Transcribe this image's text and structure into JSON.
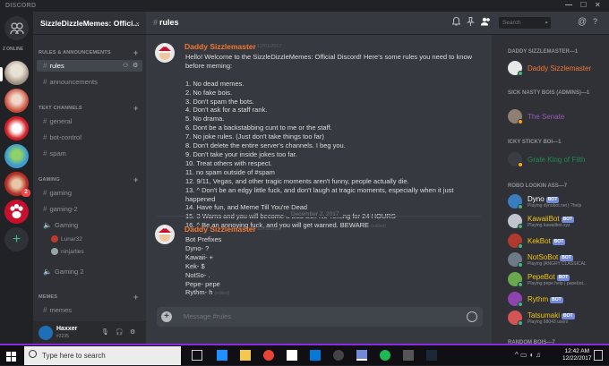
{
  "window": {
    "app_name": "DISCORD",
    "controls": [
      "—",
      "☐",
      "✕"
    ]
  },
  "rail": {
    "online_label": "2 ONLINE",
    "badge_count": "2"
  },
  "server": {
    "name": "SizzleDizzleMemes: Offici...",
    "chevron": "⌄"
  },
  "categories": {
    "rules": "RULES & ANNOUNCEMENTS",
    "text": "TEXT CHANNELS",
    "gaming": "GAMING",
    "memes": "MEMES"
  },
  "channels": {
    "rules": "rules",
    "announcements": "announcements",
    "general": "general",
    "bot_control": "bot-control",
    "spam": "spam",
    "gaming": "gaming",
    "gaming2": "gaming-2",
    "voice_gaming": "Gaming",
    "voice_gaming2": "Gaming 2",
    "memes": "memes"
  },
  "voice_members": [
    "Lunar32",
    "ninjarlles"
  ],
  "user": {
    "name": "Haxxer",
    "tag": "#2235"
  },
  "chat": {
    "channel": "rules",
    "search_placeholder": "Search",
    "composer_placeholder": "Message #rules",
    "date_divider": "December 2, 2017",
    "messages": [
      {
        "author": "Daddy Sizzlemaster",
        "time": "12/01/2017",
        "body": "Hello! Welcome to the SizzleDizzleMemes: Official Discord! Here's some rules you need to know before meming:\n\n1. No dead memes.\n2. No fake bois.\n3. Don't spam the bots.\n4. Don't ask for a staff rank.\n5. No drama.\n6. Dont be a backstabbing cunt to me or the staff.\n7. No joke rules. (Just don't take things too far)\n8. Don't delete the entire server's channels. I beg you.\n9. Don't take your inside jokes too far.\n10. Treat others with respect.\n11. no spam outside of #spam\n12. 9/11, Vegas, and other tragic moments aren't funny, people actually die.\n13. ^ Don't be an edgy little fuck, and don't laugh at tragic moments, especially when it just happened\n14. Have fun, and Meme Till You're Dead\n15. 3 Warns and you will become a Bad Boi. No Texting for 24 HOURS\n16. ^ Be an annoying fuck, and you will get warned. BEWARE",
        "edited": "(edited)"
      },
      {
        "author": "Daddy Sizzlemaster",
        "time": "12/02/2017",
        "body": "Bot Prefixes\nDyno- ?\nKawaii- +\nKek- $\nNotSo- .\nPepe- pepe\nRythm- h",
        "edited": "(edited)"
      }
    ]
  },
  "members": {
    "groups": [
      {
        "label": "DADDY SIZZLEMASTER—1",
        "members": [
          {
            "name": "Daddy Sizzlemaster",
            "color": "#f57731"
          }
        ]
      },
      {
        "label": "SICK NASTY BOIS (ADMINS)—1",
        "members": [
          {
            "name": "The Senate",
            "color": "#9b59b6"
          }
        ]
      },
      {
        "label": "ICKY STICKY BOI—1",
        "members": [
          {
            "name": "Grate King of Filth",
            "color": "#1f8b4c"
          }
        ]
      },
      {
        "label": "ROBO LOOKIN ASS—7",
        "members": [
          {
            "name": "Dyno",
            "sub": "Playing dynobot.net | ?help",
            "color": "#ffffff",
            "bot": "BOT"
          },
          {
            "name": "KawaiiBot",
            "sub": "Playing kawaiibot.xyz",
            "color": "#f1c40f",
            "bot": "BOT"
          },
          {
            "name": "KekBot",
            "color": "#f1c40f",
            "bot": "BOT"
          },
          {
            "name": "NotSoBot",
            "sub": "Playing [ANGRY CLASSICAL",
            "color": "#f1c40f",
            "bot": "BOT"
          },
          {
            "name": "PepeBot",
            "sub": "Playing pepe help | pepebot...",
            "color": "#f1c40f",
            "bot": "BOT"
          },
          {
            "name": "Rythm",
            "color": "#f1c40f",
            "bot": "BOT"
          },
          {
            "name": "Tatsumaki",
            "sub": "Playing 68043 users",
            "color": "#f1c40f",
            "bot": "BOT"
          }
        ]
      },
      {
        "label": "RANDOM BOIS—7",
        "members": []
      }
    ]
  },
  "taskbar": {
    "search_placeholder": "Type here to search",
    "time": "12:42 AM",
    "date": "12/22/2017"
  },
  "colors": {
    "accent": "#7289da",
    "online": "#43b581",
    "author": "#f57731",
    "taskbar_accent": "#8a2be2"
  }
}
